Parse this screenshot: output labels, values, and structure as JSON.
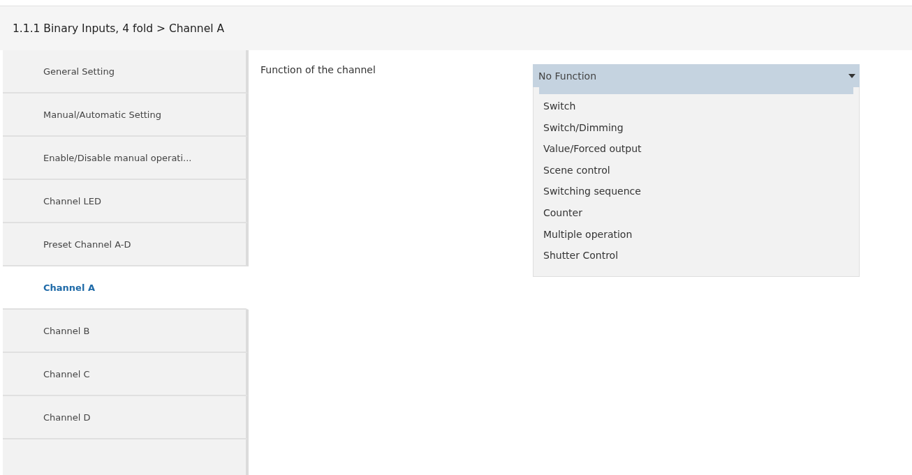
{
  "breadcrumb": "1.1.1 Binary Inputs, 4 fold > Channel A",
  "sidebar": {
    "items": [
      {
        "label": "General Setting",
        "selected": false
      },
      {
        "label": "Manual/Automatic Setting",
        "selected": false
      },
      {
        "label": "Enable/Disable manual operati...",
        "selected": false
      },
      {
        "label": "Channel LED",
        "selected": false
      },
      {
        "label": "Preset Channel A-D",
        "selected": false
      },
      {
        "label": "Channel A",
        "selected": true
      },
      {
        "label": "Channel B",
        "selected": false
      },
      {
        "label": "Channel C",
        "selected": false
      },
      {
        "label": "Channel D",
        "selected": false
      }
    ]
  },
  "parameter": {
    "label": "Function of the channel",
    "dropdown": {
      "value": "No Function",
      "options": [
        "Switch",
        "Switch/Dimming",
        "Value/Forced output",
        "Scene control",
        "Switching sequence",
        "Counter",
        "Multiple operation",
        "Shutter Control"
      ]
    }
  }
}
